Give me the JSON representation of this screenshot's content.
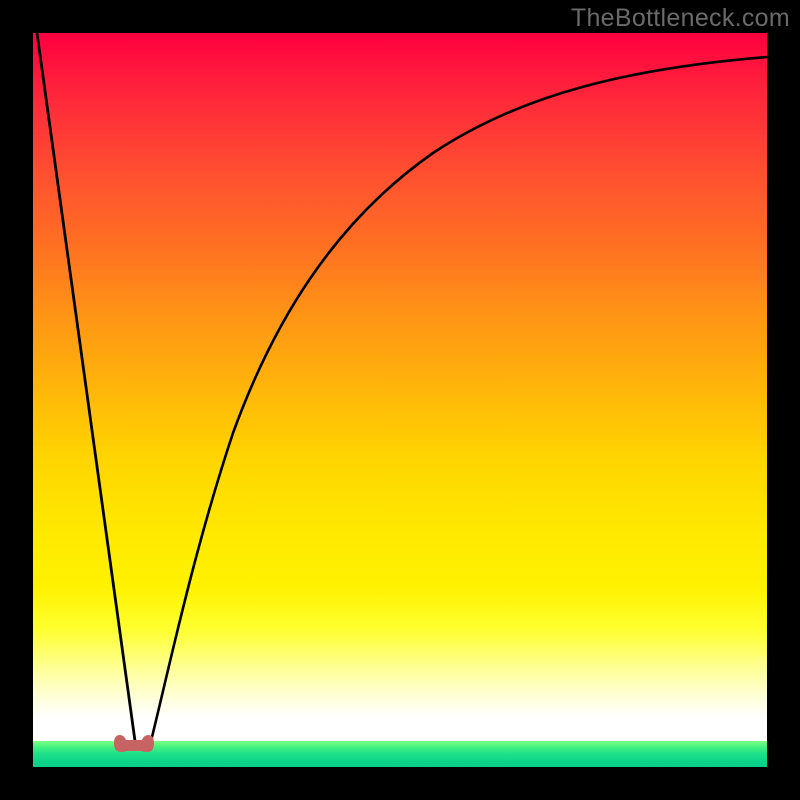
{
  "watermark_text": "TheBottleneck.com",
  "chart_data": {
    "type": "line",
    "title": "",
    "xlabel": "",
    "ylabel": "",
    "xlim": [
      0,
      100
    ],
    "ylim": [
      0,
      100
    ],
    "legend": null,
    "background": {
      "style": "vertical-gradient",
      "stops": [
        {
          "pos": 0,
          "color": "#ff0040"
        },
        {
          "pos": 50,
          "color": "#ffd500"
        },
        {
          "pos": 84,
          "color": "#ffff30"
        },
        {
          "pos": 96,
          "color": "#ffffff"
        },
        {
          "pos": 100,
          "color": "#0ace88"
        }
      ]
    },
    "series": [
      {
        "name": "bottleneck-curve",
        "x": [
          0,
          3,
          6,
          9,
          11,
          12,
          12.8,
          13.5,
          14.5,
          16,
          18,
          21,
          25,
          30,
          36,
          43,
          51,
          60,
          70,
          82,
          94,
          100
        ],
        "y": [
          100,
          82,
          64,
          46,
          28,
          18,
          10,
          4,
          1,
          2,
          8,
          18,
          30,
          42,
          54,
          64,
          73,
          80,
          85,
          89,
          91,
          92
        ]
      }
    ],
    "marker": {
      "name": "optimal-region",
      "shape": "rounded-segment",
      "x_range": [
        11.5,
        15.5
      ],
      "y": 2,
      "color": "#c76362"
    }
  }
}
